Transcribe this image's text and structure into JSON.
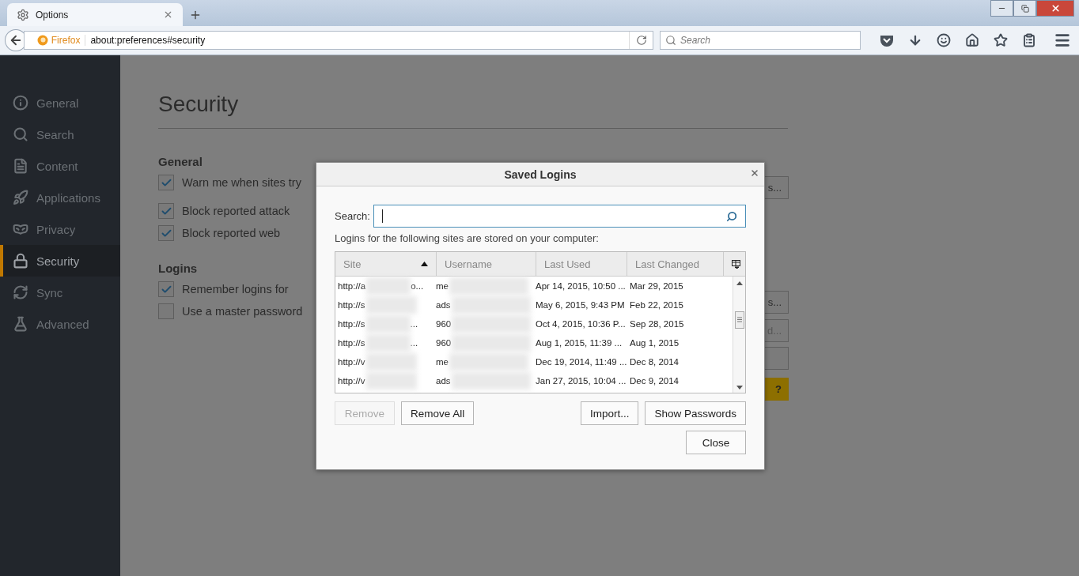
{
  "browser": {
    "tab": {
      "title": "Options",
      "selected": true
    },
    "identity": "Firefox",
    "url": "about:preferences#security",
    "search": {
      "placeholder": "Search"
    }
  },
  "sidebar": {
    "items": [
      {
        "label": "General",
        "selected": false
      },
      {
        "label": "Search",
        "selected": false
      },
      {
        "label": "Content",
        "selected": false
      },
      {
        "label": "Applications",
        "selected": false
      },
      {
        "label": "Privacy",
        "selected": false
      },
      {
        "label": "Security",
        "selected": true
      },
      {
        "label": "Sync",
        "selected": false
      },
      {
        "label": "Advanced",
        "selected": false
      }
    ]
  },
  "page": {
    "title": "Security",
    "sections": [
      {
        "heading": "General",
        "options": [
          {
            "label": "Warn me when sites try",
            "checked": true
          },
          {
            "label": "Block reported attack",
            "checked": true
          },
          {
            "label": "Block reported web",
            "checked": true
          }
        ]
      },
      {
        "heading": "Logins",
        "options": [
          {
            "label": "Remember logins for",
            "checked": true
          },
          {
            "label": "Use a master password",
            "checked": false
          }
        ]
      }
    ],
    "side_buttons": [
      {
        "label": "s...",
        "disabled": false
      },
      {
        "label": "s...",
        "disabled": false
      },
      {
        "label": "d...",
        "disabled": true
      },
      {
        "kind": "blank"
      },
      {
        "label": "?",
        "kind": "help"
      }
    ]
  },
  "dialog": {
    "title": "Saved Logins",
    "search_label": "Search:",
    "description": "Logins for the following sites are stored on your computer:",
    "columns": [
      {
        "label": "Site",
        "sorted": true
      },
      {
        "label": "Username",
        "sorted": false
      },
      {
        "label": "Last Used",
        "sorted": false
      },
      {
        "label": "Last Changed",
        "sorted": false
      }
    ],
    "rows": [
      {
        "site": "http://a",
        "site_tail": "o...",
        "username": "me",
        "last_used": "Apr 14, 2015, 10:50 ...",
        "last_changed": "Mar 29, 2015"
      },
      {
        "site": "http://s",
        "username": "ads",
        "last_used": "May 6, 2015, 9:43 PM",
        "last_changed": "Feb 22, 2015"
      },
      {
        "site": "http://s",
        "site_tail": "...",
        "username": "960",
        "last_used": "Oct 4, 2015, 10:36 P...",
        "last_changed": "Sep 28, 2015"
      },
      {
        "site": "http://s",
        "site_tail": "...",
        "username": "960",
        "last_used": "Aug 1, 2015, 11:39 ...",
        "last_changed": "Aug 1, 2015"
      },
      {
        "site": "http://v",
        "username": "me",
        "last_used": "Dec 19, 2014, 11:49 ...",
        "last_changed": "Dec 8, 2014"
      },
      {
        "site": "http://v",
        "username": "ads",
        "last_used": "Jan 27, 2015, 10:04 ...",
        "last_changed": "Dec 9, 2014"
      }
    ],
    "buttons_left": [
      {
        "label": "Remove",
        "disabled": true
      },
      {
        "label": "Remove All",
        "disabled": false
      }
    ],
    "buttons_right": [
      {
        "label": "Import...",
        "disabled": false
      },
      {
        "label": "Show Passwords",
        "disabled": false
      }
    ],
    "close_button": "Close"
  }
}
